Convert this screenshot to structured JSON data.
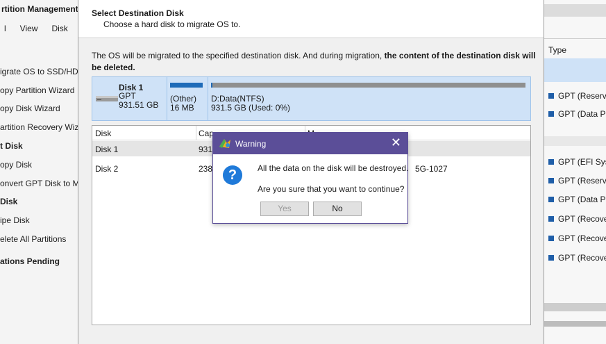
{
  "background_left": {
    "title": "rtition Management",
    "menu": [
      "l",
      "View",
      "Disk"
    ],
    "items": [
      {
        "label": "igrate OS to SSD/HD",
        "bold": false
      },
      {
        "label": "opy Partition Wizard",
        "bold": false
      },
      {
        "label": "opy Disk Wizard",
        "bold": false
      },
      {
        "label": "artition Recovery Wiz",
        "bold": false
      },
      {
        "label": "t Disk",
        "bold": true
      },
      {
        "label": "opy Disk",
        "bold": false
      },
      {
        "label": "onvert GPT Disk to M",
        "bold": false
      },
      {
        "label": "Disk",
        "bold": true
      },
      {
        "label": "ipe Disk",
        "bold": false
      },
      {
        "label": "elete All Partitions",
        "bold": false
      },
      {
        "label": "ations Pending",
        "bold": true
      }
    ]
  },
  "background_right": {
    "type_header": "Type",
    "rows": [
      "GPT (Reserved",
      "GPT (Data Par",
      "GPT (EFI Syste",
      "GPT (Reserved",
      "GPT (Data Par",
      "GPT (Recovery",
      "GPT (Recovery",
      "GPT (Recovery"
    ]
  },
  "dialog": {
    "title": "Select Destination Disk",
    "subtitle": "Choose a hard disk to migrate OS to.",
    "info_prefix": "The OS will be migrated to the specified destination disk. And during migration, ",
    "info_bold": "the content of the destination disk will be deleted",
    "info_suffix": ".",
    "disk": {
      "name": "Disk 1",
      "type": "GPT",
      "size": "931.51 GB",
      "partitions": [
        {
          "name": "(Other)",
          "size": "16 MB"
        },
        {
          "name": "D:Data(NTFS)",
          "size": "931.5 GB (Used: 0%)",
          "used_fraction": 0.0
        }
      ]
    },
    "table": {
      "headers": [
        "Disk",
        "Cap",
        "M"
      ],
      "rows": [
        {
          "disk": "Disk 1",
          "capacity": "931",
          "model": ""
        },
        {
          "disk": "Disk 2",
          "capacity": "238",
          "model": "5G-1027"
        }
      ]
    }
  },
  "warning": {
    "title": "Warning",
    "close_glyph": "✕",
    "question_glyph": "?",
    "message1": "All the data on the disk will be destroyed.",
    "message2": "Are you sure that you want to continue?",
    "yes_label": "Yes",
    "no_label": "No"
  }
}
